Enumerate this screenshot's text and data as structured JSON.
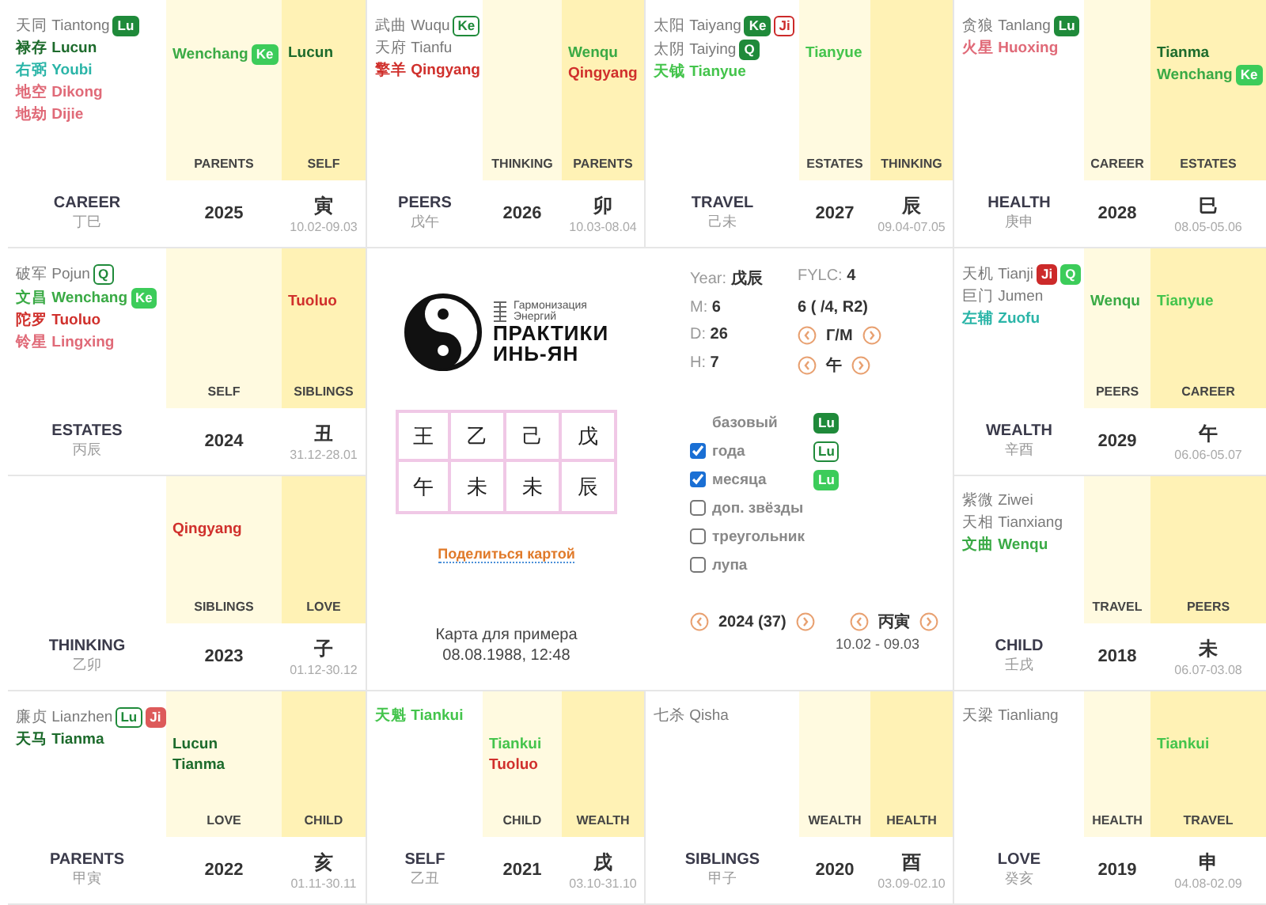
{
  "cells": [
    {
      "stars": [
        {
          "text": "天同 Tiantong",
          "kind": "major",
          "color": "#7a7a7a",
          "badges": [
            {
              "text": "Lu",
              "color": "#1f8a3a",
              "filled": true
            }
          ]
        },
        {
          "text": "禄存 Lucun",
          "kind": "minor",
          "color": "#1d6b2c"
        },
        {
          "text": "右弼 Youbi",
          "kind": "minor",
          "color": "#2bb5a8"
        },
        {
          "text": "地空 Dikong",
          "kind": "minor",
          "color": "#e06a78"
        },
        {
          "text": "地劫 Dijie",
          "kind": "minor",
          "color": "#e06a78"
        }
      ],
      "col_a": {
        "stars": [
          {
            "text": "Wenchang",
            "color": "#3aaa45",
            "badges": [
              {
                "text": "Ke",
                "color": "#3ccc5a",
                "filled": true
              }
            ]
          }
        ],
        "label": "PARENTS"
      },
      "col_b": {
        "stars": [
          {
            "text": "Lucun",
            "color": "#1d6b2c"
          }
        ],
        "label": "SELF"
      },
      "palace": "CAREER",
      "stem": "丁巳",
      "year": "2025",
      "branch": "寅",
      "dates": "10.02-09.03"
    },
    {
      "stars": [
        {
          "text": "武曲 Wuqu",
          "kind": "major",
          "color": "#7a7a7a",
          "badges": [
            {
              "text": "Ke",
              "color": "#1f8a3a",
              "filled": false
            }
          ]
        },
        {
          "text": "天府 Tianfu",
          "kind": "major",
          "color": "#7a7a7a"
        },
        {
          "text": "擎羊 Qingyang",
          "kind": "minor",
          "color": "#d0302c"
        }
      ],
      "col_a": {
        "label": "THINKING"
      },
      "col_b": {
        "stars": [
          {
            "text": "Wenqu",
            "color": "#3aaa45"
          },
          {
            "text": "Qingyang",
            "color": "#d0302c"
          }
        ],
        "label": "PARENTS"
      },
      "palace": "PEERS",
      "stem": "戊午",
      "year": "2026",
      "branch": "卯",
      "dates": "10.03-08.04"
    },
    {
      "stars": [
        {
          "text": "太阳 Taiyang",
          "kind": "major",
          "color": "#7a7a7a",
          "badges": [
            {
              "text": "Ke",
              "color": "#1f8a3a",
              "filled": true
            },
            {
              "text": "Ji",
              "color": "#cc2a2a",
              "filled": false
            }
          ]
        },
        {
          "text": "太阴 Taiying",
          "kind": "major",
          "color": "#7a7a7a",
          "badges": [
            {
              "text": "Q",
              "color": "#1f8a3a",
              "filled": true
            }
          ]
        },
        {
          "text": "天钺 Tianyue",
          "kind": "minor",
          "color": "#44c44c"
        }
      ],
      "col_a": {
        "stars": [
          {
            "text": "Tianyue",
            "color": "#44c44c"
          }
        ],
        "label": "ESTATES"
      },
      "col_b": {
        "label": "THINKING"
      },
      "palace": "TRAVEL",
      "stem": "己未",
      "year": "2027",
      "branch": "辰",
      "dates": "09.04-07.05"
    },
    {
      "stars": [
        {
          "text": "贪狼 Tanlang",
          "kind": "major",
          "color": "#7a7a7a",
          "badges": [
            {
              "text": "Lu",
              "color": "#1f8a3a",
              "filled": true
            }
          ]
        },
        {
          "text": "火星 Huoxing",
          "kind": "minor",
          "color": "#e06a78"
        }
      ],
      "col_a": {
        "label": "CAREER"
      },
      "col_b": {
        "stars": [
          {
            "text": "Tianma",
            "color": "#1d6b2c"
          },
          {
            "text": "Wenchang",
            "color": "#3aaa45",
            "badges": [
              {
                "text": "Ke",
                "color": "#3ccc5a",
                "filled": true
              }
            ]
          }
        ],
        "label": "ESTATES"
      },
      "palace": "HEALTH",
      "stem": "庚申",
      "year": "2028",
      "branch": "巳",
      "dates": "08.05-05.06"
    },
    {
      "stars": [
        {
          "text": "破军 Pojun",
          "kind": "major",
          "color": "#7a7a7a",
          "badges": [
            {
              "text": "Q",
              "color": "#1f8a3a",
              "filled": false
            }
          ]
        },
        {
          "text": "文昌 Wenchang",
          "kind": "minor",
          "color": "#3aaa45",
          "badges": [
            {
              "text": "Ke",
              "color": "#3ccc5a",
              "filled": true
            }
          ]
        },
        {
          "text": "陀罗 Tuoluo",
          "kind": "minor",
          "color": "#d0302c"
        },
        {
          "text": "铃星 Lingxing",
          "kind": "minor",
          "color": "#e06a78"
        }
      ],
      "col_a": {
        "label": "SELF"
      },
      "col_b": {
        "stars": [
          {
            "text": "Tuoluo",
            "color": "#d0302c"
          }
        ],
        "label": "SIBLINGS"
      },
      "palace": "ESTATES",
      "stem": "丙辰",
      "year": "2024",
      "branch": "丑",
      "dates": "31.12-28.01"
    },
    {
      "stars": [
        {
          "text": "天机 Tianji",
          "kind": "major",
          "color": "#7a7a7a",
          "badges": [
            {
              "text": "Ji",
              "color": "#cc2a2a",
              "filled": true
            },
            {
              "text": "Q",
              "color": "#3ccc5a",
              "filled": true
            }
          ]
        },
        {
          "text": "巨门 Jumen",
          "kind": "major",
          "color": "#7a7a7a"
        },
        {
          "text": "左辅 Zuofu",
          "kind": "minor",
          "color": "#2bb5a8"
        }
      ],
      "col_a": {
        "stars": [
          {
            "text": "Wenqu",
            "color": "#3aaa45"
          }
        ],
        "label": "PEERS"
      },
      "col_b": {
        "stars": [
          {
            "text": "Tianyue",
            "color": "#44c44c"
          }
        ],
        "label": "CAREER"
      },
      "palace": "WEALTH",
      "stem": "辛酉",
      "year": "2029",
      "branch": "午",
      "dates": "06.06-05.07"
    },
    {
      "col_a": {
        "stars": [
          {
            "text": "Qingyang",
            "color": "#d0302c"
          }
        ],
        "label": "SIBLINGS"
      },
      "col_b": {
        "label": "LOVE"
      },
      "palace": "THINKING",
      "stem": "乙卯",
      "year": "2023",
      "branch": "子",
      "dates": "01.12-30.12"
    },
    {
      "stars": [
        {
          "text": "紫微 Ziwei",
          "kind": "major",
          "color": "#7a7a7a"
        },
        {
          "text": "天相 Tianxiang",
          "kind": "major",
          "color": "#7a7a7a"
        },
        {
          "text": "文曲 Wenqu",
          "kind": "minor",
          "color": "#3aaa45"
        }
      ],
      "col_a": {
        "label": "TRAVEL"
      },
      "col_b": {
        "label": "PEERS"
      },
      "palace": "CHILD",
      "stem": "壬戌",
      "year": "2018",
      "branch": "未",
      "dates": "06.07-03.08"
    },
    {
      "stars": [
        {
          "text": "廉贞 Lianzhen",
          "kind": "major",
          "color": "#7a7a7a",
          "badges": [
            {
              "text": "Lu",
              "color": "#1f8a3a",
              "filled": false
            },
            {
              "text": "Ji",
              "color": "#dd5a5a",
              "filled": true
            }
          ]
        },
        {
          "text": "天马 Tianma",
          "kind": "minor",
          "color": "#1d6b2c"
        }
      ],
      "col_a": {
        "stars": [
          {
            "text": "Lucun",
            "color": "#1d6b2c"
          },
          {
            "text": "Tianma",
            "color": "#1d6b2c"
          }
        ],
        "label": "LOVE"
      },
      "col_b": {
        "label": "CHILD"
      },
      "palace": "PARENTS",
      "stem": "甲寅",
      "year": "2022",
      "branch": "亥",
      "dates": "01.11-30.11"
    },
    {
      "stars": [
        {
          "text": "天魁 Tiankui",
          "kind": "minor",
          "color": "#44c44c"
        }
      ],
      "col_a": {
        "stars": [
          {
            "text": "Tiankui",
            "color": "#44c44c"
          },
          {
            "text": "Tuoluo",
            "color": "#d0302c"
          }
        ],
        "label": "CHILD"
      },
      "col_b": {
        "label": "WEALTH"
      },
      "palace": "SELF",
      "stem": "乙丑",
      "year": "2021",
      "branch": "戌",
      "dates": "03.10-31.10"
    },
    {
      "stars": [
        {
          "text": "七杀 Qisha",
          "kind": "major",
          "color": "#7a7a7a"
        }
      ],
      "col_a": {
        "label": "WEALTH"
      },
      "col_b": {
        "label": "HEALTH"
      },
      "palace": "SIBLINGS",
      "stem": "甲子",
      "year": "2020",
      "branch": "酉",
      "dates": "03.09-02.10"
    },
    {
      "stars": [
        {
          "text": "天梁 Tianliang",
          "kind": "major",
          "color": "#7a7a7a"
        }
      ],
      "col_a": {
        "label": "HEALTH"
      },
      "col_b": {
        "stars": [
          {
            "text": "Tiankui",
            "color": "#44c44c"
          }
        ],
        "label": "TRAVEL"
      },
      "palace": "LOVE",
      "stem": "癸亥",
      "year": "2019",
      "branch": "申",
      "dates": "04.08-02.09"
    }
  ],
  "center": {
    "logo": {
      "tagline": [
        "Гармонизация",
        "Энергий"
      ],
      "title": [
        "ПРАКТИКИ",
        "ИНЬ-ЯН"
      ]
    },
    "bazi": {
      "stems": [
        "王",
        "乙",
        "己",
        "戊"
      ],
      "branches": [
        "午",
        "未",
        "未",
        "辰"
      ]
    },
    "share_link": "Поделиться картой",
    "caption": "Карта для примера",
    "date": "08.08.1988, 12:48"
  },
  "info": {
    "params": [
      {
        "label": "Year:",
        "value": "戊辰"
      },
      {
        "label": "M:",
        "value": "6"
      },
      {
        "label": "D:",
        "value": "26"
      },
      {
        "label": "H:",
        "value": "7"
      }
    ],
    "extra": [
      {
        "kind": "text",
        "label": "FYLC:",
        "value": "4"
      },
      {
        "kind": "text",
        "value": "6 ( /4, R2)"
      },
      {
        "kind": "stepper",
        "value": "Г/М"
      },
      {
        "kind": "stepper",
        "value": "午"
      }
    ],
    "options": [
      {
        "kind": "plain",
        "label": "базовый",
        "badge": {
          "text": "Lu",
          "color": "#1f8a3a",
          "filled": true
        }
      },
      {
        "kind": "checkbox",
        "label": "года",
        "checked": true,
        "badge": {
          "text": "Lu",
          "color": "#1f8a3a",
          "filled": false
        }
      },
      {
        "kind": "checkbox",
        "label": "месяца",
        "checked": true,
        "badge": {
          "text": "Lu",
          "color": "#3ccc5a",
          "filled": true
        }
      },
      {
        "kind": "checkbox",
        "label": "доп. звёзды",
        "checked": false
      },
      {
        "kind": "checkbox",
        "label": "треугольник",
        "checked": false
      },
      {
        "kind": "checkbox",
        "label": "лупа",
        "checked": false
      }
    ],
    "period": {
      "year": "2024 (37)",
      "pillar": "丙寅",
      "dates": "10.02 - 09.03"
    }
  }
}
